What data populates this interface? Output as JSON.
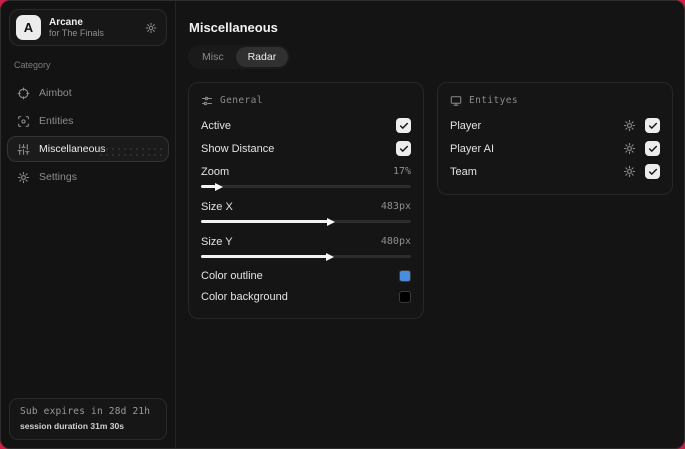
{
  "app": {
    "logo_letter": "A",
    "name": "Arcane",
    "subtitle": "for The Finals"
  },
  "sidebar": {
    "category_label": "Category",
    "items": [
      {
        "label": "Aimbot",
        "icon": "crosshair-icon",
        "active": false
      },
      {
        "label": "Entities",
        "icon": "scan-icon",
        "active": false
      },
      {
        "label": "Miscellaneous",
        "icon": "sliders-icon",
        "active": true
      },
      {
        "label": "Settings",
        "icon": "gear-icon",
        "active": false
      }
    ],
    "footer": {
      "sub_expiry": "Sub expires in 28d 21h",
      "session_duration": "session duration 31m 30s"
    }
  },
  "main": {
    "title": "Miscellaneous",
    "tabs": [
      {
        "label": "Misc",
        "active": false
      },
      {
        "label": "Radar",
        "active": true
      }
    ],
    "general_panel": {
      "title": "General",
      "active": {
        "label": "Active",
        "checked": true
      },
      "show_distance": {
        "label": "Show Distance",
        "checked": true
      },
      "zoom": {
        "label": "Zoom",
        "value": "17%",
        "fill_pct": 7
      },
      "size_x": {
        "label": "Size X",
        "value": "483px",
        "fill_pct": 60.4
      },
      "size_y": {
        "label": "Size Y",
        "value": "480px",
        "fill_pct": 60
      },
      "color_outline": {
        "label": "Color outline",
        "color": "#4a8cdf"
      },
      "color_background": {
        "label": "Color background",
        "color": "#000000"
      }
    },
    "entities_panel": {
      "title": "Entityes",
      "rows": [
        {
          "label": "Player",
          "checked": true
        },
        {
          "label": "Player AI",
          "checked": true
        },
        {
          "label": "Team",
          "checked": true
        }
      ]
    }
  },
  "colors": {
    "accent_red": "#cf2047",
    "swatch_blue": "#4a8cdf",
    "swatch_black": "#000000"
  }
}
